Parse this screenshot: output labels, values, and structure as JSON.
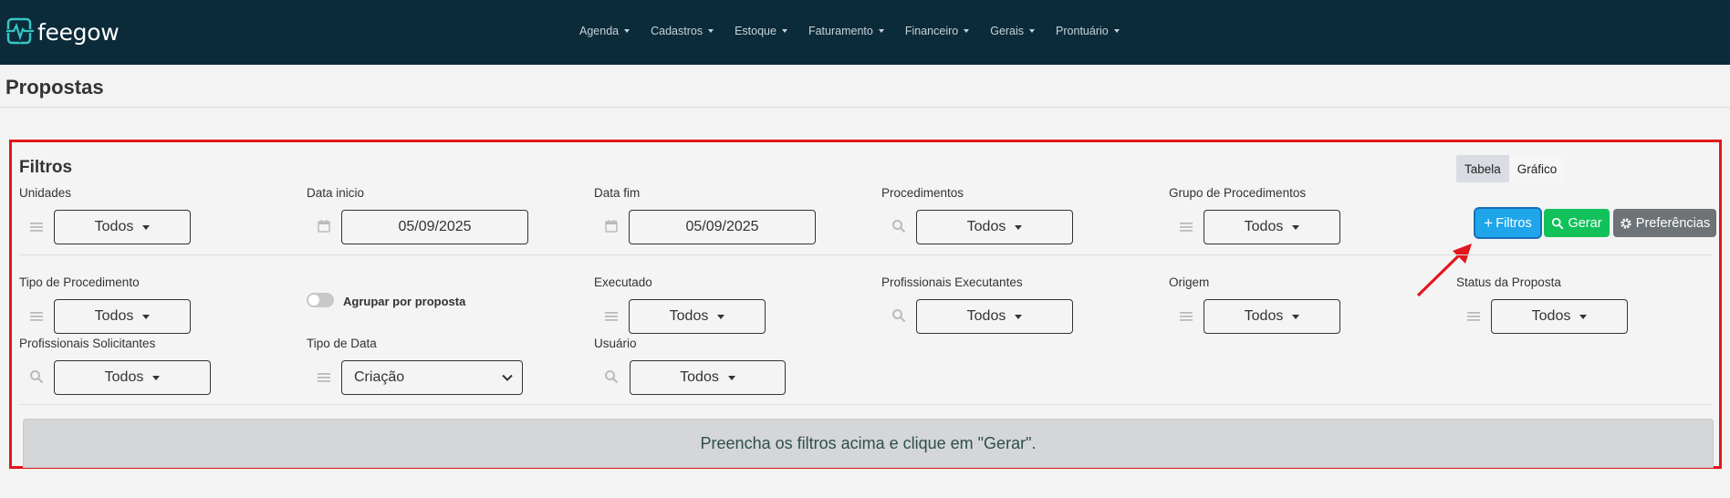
{
  "app": {
    "logo_text": "feegow"
  },
  "nav": {
    "items": [
      {
        "label": "Agenda"
      },
      {
        "label": "Cadastros"
      },
      {
        "label": "Estoque"
      },
      {
        "label": "Faturamento"
      },
      {
        "label": "Financeiro"
      },
      {
        "label": "Gerais"
      },
      {
        "label": "Prontuário"
      }
    ]
  },
  "page": {
    "title": "Propostas"
  },
  "filters": {
    "title": "Filtros",
    "view_toggle": {
      "table": "Tabela",
      "chart": "Gráfico",
      "active": "Tabela"
    },
    "unidades": {
      "label": "Unidades",
      "value": "Todos",
      "icon": "list-icon"
    },
    "data_inicio": {
      "label": "Data inicio",
      "value": "05/09/2025",
      "icon": "calendar-icon"
    },
    "data_fim": {
      "label": "Data fim",
      "value": "05/09/2025",
      "icon": "calendar-icon"
    },
    "procedimentos": {
      "label": "Procedimentos",
      "value": "Todos",
      "icon": "search-icon"
    },
    "grupo_procedimentos": {
      "label": "Grupo de Procedimentos",
      "value": "Todos",
      "icon": "list-icon"
    },
    "tipo_procedimento": {
      "label": "Tipo de Procedimento",
      "value": "Todos",
      "icon": "list-icon"
    },
    "agrupar": {
      "label": "Agrupar por proposta",
      "checked": false
    },
    "executado": {
      "label": "Executado",
      "value": "Todos",
      "icon": "list-icon"
    },
    "prof_executantes": {
      "label": "Profissionais Executantes",
      "value": "Todos",
      "icon": "search-icon"
    },
    "origem": {
      "label": "Origem",
      "value": "Todos",
      "icon": "list-icon"
    },
    "status_proposta": {
      "label": "Status da Proposta",
      "value": "Todos",
      "icon": "list-icon"
    },
    "prof_solicitantes": {
      "label": "Profissionais Solicitantes",
      "value": "Todos",
      "icon": "search-icon"
    },
    "tipo_data": {
      "label": "Tipo de Data",
      "value": "Criação",
      "icon": "list-icon"
    },
    "usuario": {
      "label": "Usuário",
      "value": "Todos",
      "icon": "search-icon"
    }
  },
  "actions": {
    "filtros": "Filtros",
    "gerar": "Gerar",
    "preferencias": "Preferências"
  },
  "message": "Preencha os filtros acima e clique em \"Gerar\".",
  "colors": {
    "navbar": "#0c2b3a",
    "filtros_button": "#1fa6ea",
    "gerar_button": "#12c15a",
    "preferencias_button": "#6d7377",
    "highlight": "#e2161d"
  }
}
